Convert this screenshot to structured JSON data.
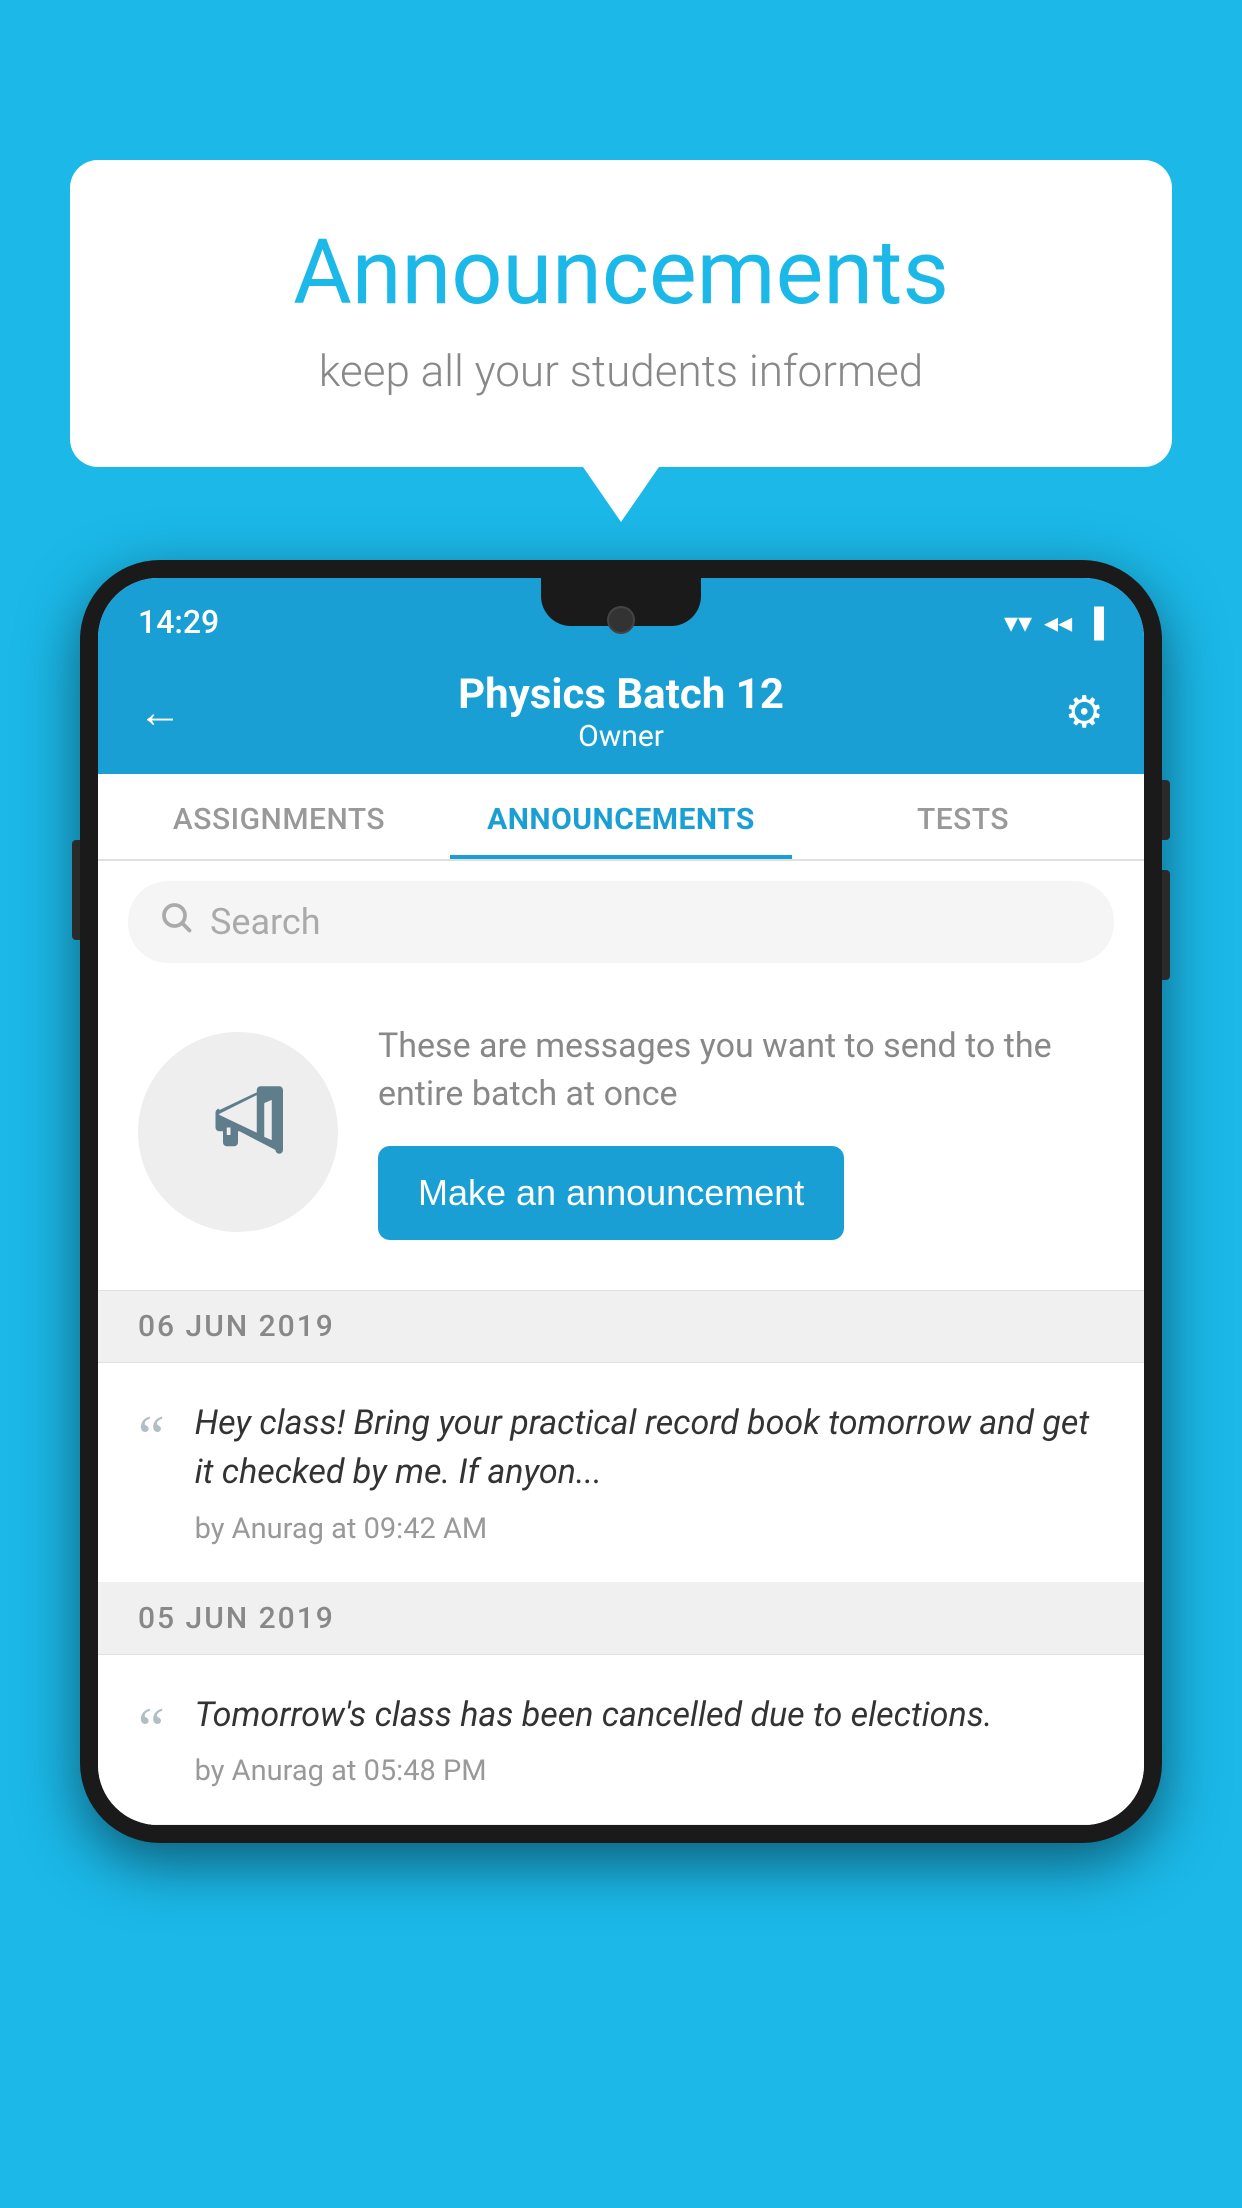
{
  "background_color": "#1BB8E8",
  "speech_bubble": {
    "title": "Announcements",
    "subtitle": "keep all your students informed"
  },
  "phone": {
    "status_bar": {
      "time": "14:29",
      "wifi": "▲",
      "signal": "◀",
      "battery": "▐"
    },
    "header": {
      "title": "Physics Batch 12",
      "subtitle": "Owner",
      "back_label": "←",
      "settings_label": "⚙"
    },
    "tabs": [
      {
        "label": "ASSIGNMENTS",
        "active": false
      },
      {
        "label": "ANNOUNCEMENTS",
        "active": true
      },
      {
        "label": "TESTS",
        "active": false
      }
    ],
    "search": {
      "placeholder": "Search"
    },
    "prompt": {
      "description": "These are messages you want to send to the entire batch at once",
      "button_label": "Make an announcement"
    },
    "announcements": [
      {
        "date": "06  JUN  2019",
        "text": "Hey class! Bring your practical record book tomorrow and get it checked by me. If anyon...",
        "meta": "by Anurag at 09:42 AM"
      },
      {
        "date": "05  JUN  2019",
        "text": "Tomorrow's class has been cancelled due to elections.",
        "meta": "by Anurag at 05:48 PM"
      }
    ]
  }
}
